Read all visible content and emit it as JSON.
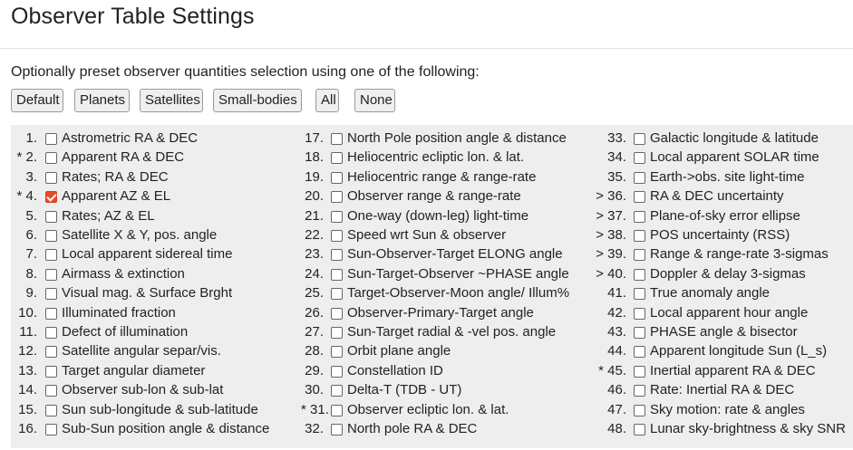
{
  "page": {
    "title": "Observer Table Settings",
    "intro": "Optionally preset observer quantities selection using one of the following:"
  },
  "presets": [
    "Default",
    "Planets",
    "Satellites",
    "Small-bodies",
    "All",
    "None"
  ],
  "quantities": [
    {
      "num": "1.",
      "label": "Astrometric RA & DEC",
      "checked": false
    },
    {
      "num": "* 2.",
      "label": "Apparent RA & DEC",
      "checked": false
    },
    {
      "num": "3.",
      "label": "Rates; RA & DEC",
      "checked": false
    },
    {
      "num": "* 4.",
      "label": "Apparent AZ & EL",
      "checked": true
    },
    {
      "num": "5.",
      "label": "Rates; AZ & EL",
      "checked": false
    },
    {
      "num": "6.",
      "label": "Satellite X & Y, pos. angle",
      "checked": false
    },
    {
      "num": "7.",
      "label": "Local apparent sidereal time",
      "checked": false
    },
    {
      "num": "8.",
      "label": "Airmass & extinction",
      "checked": false
    },
    {
      "num": "9.",
      "label": "Visual mag. & Surface Brght",
      "checked": false
    },
    {
      "num": "10.",
      "label": "Illuminated fraction",
      "checked": false
    },
    {
      "num": "11.",
      "label": "Defect of illumination",
      "checked": false
    },
    {
      "num": "12.",
      "label": "Satellite angular separ/vis.",
      "checked": false
    },
    {
      "num": "13.",
      "label": "Target angular diameter",
      "checked": false
    },
    {
      "num": "14.",
      "label": "Observer sub-lon & sub-lat",
      "checked": false
    },
    {
      "num": "15.",
      "label": "Sun sub-longitude & sub-latitude",
      "checked": false
    },
    {
      "num": "16.",
      "label": "Sub-Sun position angle & distance",
      "checked": false
    },
    {
      "num": "17.",
      "label": "North Pole position angle & distance",
      "checked": false
    },
    {
      "num": "18.",
      "label": "Heliocentric ecliptic lon. & lat.",
      "checked": false
    },
    {
      "num": "19.",
      "label": "Heliocentric range & range-rate",
      "checked": false
    },
    {
      "num": "20.",
      "label": "Observer range & range-rate",
      "checked": false
    },
    {
      "num": "21.",
      "label": "One-way (down-leg) light-time",
      "checked": false
    },
    {
      "num": "22.",
      "label": "Speed wrt Sun & observer",
      "checked": false
    },
    {
      "num": "23.",
      "label": "Sun-Observer-Target ELONG angle",
      "checked": false
    },
    {
      "num": "24.",
      "label": "Sun-Target-Observer ~PHASE angle",
      "checked": false
    },
    {
      "num": "25.",
      "label": "Target-Observer-Moon angle/ Illum%",
      "checked": false
    },
    {
      "num": "26.",
      "label": "Observer-Primary-Target angle",
      "checked": false
    },
    {
      "num": "27.",
      "label": "Sun-Target radial & -vel pos. angle",
      "checked": false
    },
    {
      "num": "28.",
      "label": "Orbit plane angle",
      "checked": false
    },
    {
      "num": "29.",
      "label": "Constellation ID",
      "checked": false
    },
    {
      "num": "30.",
      "label": "Delta-T (TDB - UT)",
      "checked": false
    },
    {
      "num": "* 31.",
      "label": "Observer ecliptic lon. & lat.",
      "checked": false
    },
    {
      "num": "32.",
      "label": "North pole RA & DEC",
      "checked": false
    },
    {
      "num": "33.",
      "label": "Galactic longitude & latitude",
      "checked": false
    },
    {
      "num": "34.",
      "label": "Local apparent SOLAR time",
      "checked": false
    },
    {
      "num": "35.",
      "label": "Earth->obs. site light-time",
      "checked": false
    },
    {
      "num": "> 36.",
      "label": "RA & DEC uncertainty",
      "checked": false
    },
    {
      "num": "> 37.",
      "label": "Plane-of-sky error ellipse",
      "checked": false
    },
    {
      "num": "> 38.",
      "label": "POS uncertainty (RSS)",
      "checked": false
    },
    {
      "num": "> 39.",
      "label": "Range & range-rate 3-sigmas",
      "checked": false
    },
    {
      "num": "> 40.",
      "label": "Doppler & delay 3-sigmas",
      "checked": false
    },
    {
      "num": "41.",
      "label": "True anomaly angle",
      "checked": false
    },
    {
      "num": "42.",
      "label": "Local apparent hour angle",
      "checked": false
    },
    {
      "num": "43.",
      "label": "PHASE angle & bisector",
      "checked": false
    },
    {
      "num": "44.",
      "label": "Apparent longitude Sun (L_s)",
      "checked": false
    },
    {
      "num": "* 45.",
      "label": "Inertial apparent RA & DEC",
      "checked": false
    },
    {
      "num": "46.",
      "label": "Rate: Inertial RA & DEC",
      "checked": false
    },
    {
      "num": "47.",
      "label": "Sky motion: rate & angles",
      "checked": false
    },
    {
      "num": "48.",
      "label": "Lunar sky-brightness & sky SNR",
      "checked": false
    }
  ]
}
